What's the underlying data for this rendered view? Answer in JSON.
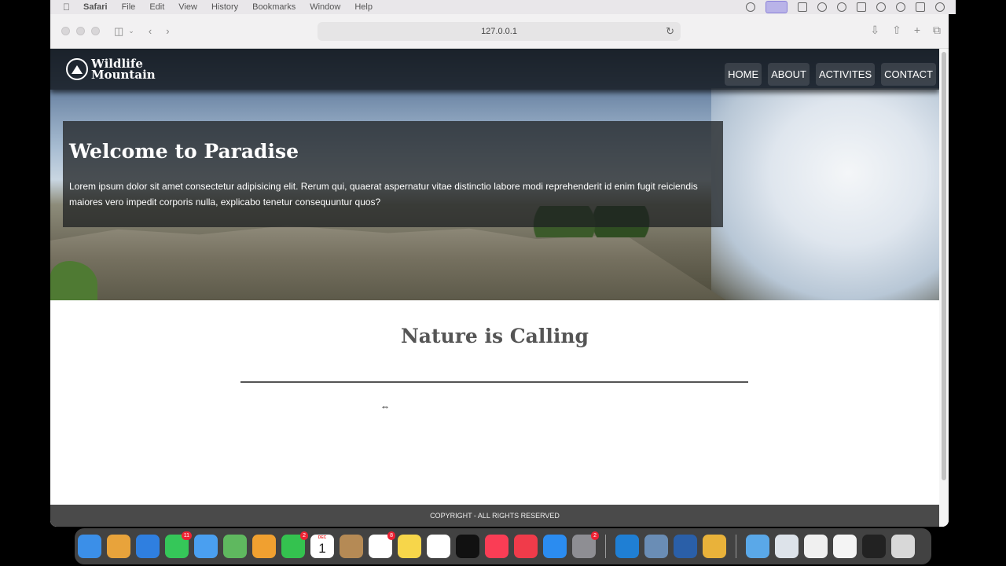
{
  "menubar": {
    "app": "Safari",
    "items": [
      "File",
      "Edit",
      "View",
      "History",
      "Bookmarks",
      "Window",
      "Help"
    ]
  },
  "browser": {
    "url": "127.0.0.1"
  },
  "site": {
    "logo_line1": "Wildlife",
    "logo_line2": "Mountain",
    "nav": [
      "HOME",
      "ABOUT",
      "ACTIVITES",
      "CONTACT"
    ],
    "hero": {
      "title": "Welcome to Paradise",
      "text": "Lorem ipsum dolor sit amet consectetur adipisicing elit. Rerum qui, quaerat aspernatur vitae distinctio labore modi reprehenderit id enim fugit reiciendis maiores vero impedit corporis nulla, explicabo tenetur consequuntur quos?"
    },
    "section_title": "Nature is Calling",
    "footer": "COPYRIGHT - ALL RIGHTS RESERVED"
  },
  "dock": {
    "apps": [
      {
        "name": "finder-icon",
        "color": "#3b8fe8"
      },
      {
        "name": "launchpad-icon",
        "color": "#e8a33b"
      },
      {
        "name": "safari-icon",
        "color": "#2f7fe0"
      },
      {
        "name": "messages-icon",
        "color": "#35c759",
        "badge": "11"
      },
      {
        "name": "mail-icon",
        "color": "#4a9ff0"
      },
      {
        "name": "maps-icon",
        "color": "#5fb85f"
      },
      {
        "name": "photos-icon",
        "color": "#f0a030"
      },
      {
        "name": "facetime-icon",
        "color": "#34c24f",
        "badge": "2"
      },
      {
        "name": "calendar-icon",
        "color": "#ffffff",
        "month": "DEC",
        "day": "1"
      },
      {
        "name": "contacts-icon",
        "color": "#b58a55"
      },
      {
        "name": "reminders-icon",
        "color": "#ffffff",
        "badge": "8"
      },
      {
        "name": "notes-icon",
        "color": "#f7d64a"
      },
      {
        "name": "freeform-icon",
        "color": "#ffffff"
      },
      {
        "name": "appletv-icon",
        "color": "#111111"
      },
      {
        "name": "music-icon",
        "color": "#fa3d55"
      },
      {
        "name": "news-icon",
        "color": "#f03b4a"
      },
      {
        "name": "appstore-icon",
        "color": "#2b8cf0"
      },
      {
        "name": "system-settings-icon",
        "color": "#8e8e93",
        "badge": "2"
      },
      {
        "name": "vscode-icon",
        "color": "#1f7fd4"
      },
      {
        "name": "preview-icon",
        "color": "#6a8db5"
      },
      {
        "name": "quicktime-icon",
        "color": "#2a5fa8"
      },
      {
        "name": "chrome-icon",
        "color": "#e9b23a"
      },
      {
        "name": "downloads-folder-icon",
        "color": "#5aa8e8"
      },
      {
        "name": "recent-window-icon-1",
        "color": "#dde3ea"
      },
      {
        "name": "recent-window-icon-2",
        "color": "#f0f0f0"
      },
      {
        "name": "recent-window-icon-3",
        "color": "#f4f4f4"
      },
      {
        "name": "recent-window-icon-4",
        "color": "#222222"
      },
      {
        "name": "trash-icon",
        "color": "#d8d8d8"
      }
    ]
  }
}
